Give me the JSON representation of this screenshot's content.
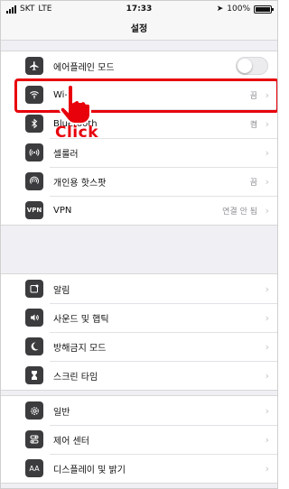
{
  "status_bar": {
    "carrier": "SKT",
    "network": "LTE",
    "time": "17:33",
    "battery": "100%",
    "battery_level": 1.0
  },
  "header": {
    "title": "설정"
  },
  "groups": [
    {
      "items": [
        {
          "label": "에어플레인 모드",
          "value": "",
          "control": "toggle",
          "toggle_on": false,
          "icon": "airplane-icon"
        },
        {
          "label": "Wi-Fi",
          "value": "끔",
          "icon": "wifi-icon"
        },
        {
          "label": "Bluetooth",
          "value": "켬",
          "icon": "bluetooth-icon"
        },
        {
          "label": "셀룰러",
          "value": "",
          "icon": "cellular-icon"
        },
        {
          "label": "개인용 핫스팟",
          "value": "끔",
          "icon": "hotspot-icon"
        },
        {
          "label": "VPN",
          "value": "연결 안 됨",
          "icon": "vpn-icon"
        }
      ]
    },
    {
      "items": [
        {
          "label": "알림",
          "value": "",
          "icon": "notifications-icon"
        },
        {
          "label": "사운드 및 햅틱",
          "value": "",
          "icon": "sound-icon"
        },
        {
          "label": "방해금지 모드",
          "value": "",
          "icon": "moon-icon"
        },
        {
          "label": "스크린 타임",
          "value": "",
          "icon": "hourglass-icon"
        }
      ]
    },
    {
      "items": [
        {
          "label": "일반",
          "value": "",
          "icon": "gear-icon"
        },
        {
          "label": "제어 센터",
          "value": "",
          "icon": "toggles-icon"
        },
        {
          "label": "디스플레이 및 밝기",
          "value": "",
          "icon": "display-icon"
        }
      ]
    }
  ],
  "annotation": {
    "text": "Click",
    "color": "#e8000b",
    "icon": "pointing-hand-icon"
  },
  "colors": {
    "icon_bg": "#3c3c3e",
    "group_bg": "#ffffff",
    "page_bg": "#efeff4",
    "value_text": "#8e8e93"
  }
}
